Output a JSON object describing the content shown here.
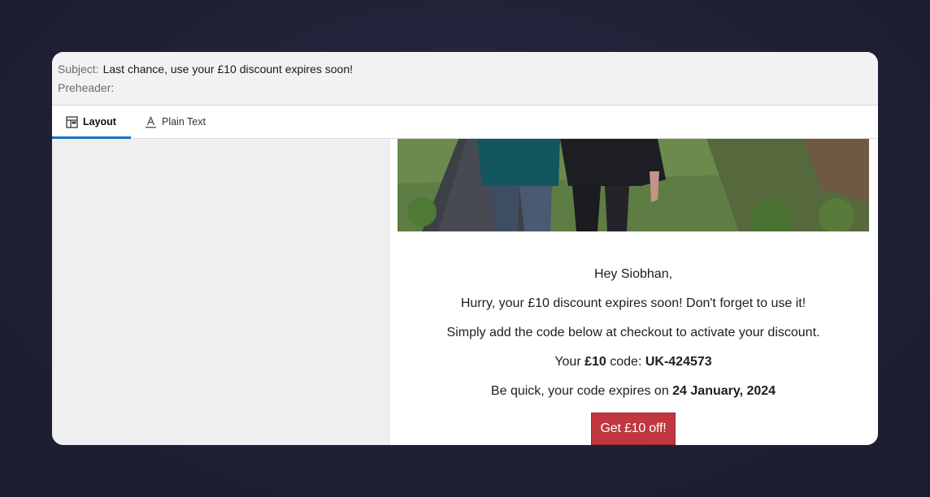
{
  "header": {
    "subject_label": "Subject:",
    "subject_value": "Last chance, use your £10 discount expires soon!",
    "preheader_label": "Preheader:",
    "preheader_value": ""
  },
  "tabs": [
    {
      "label": "Layout",
      "icon": "layout-icon",
      "active": true
    },
    {
      "label": "Plain Text",
      "icon": "text-format-icon",
      "active": false
    }
  ],
  "email": {
    "greeting": "Hey Siobhan,",
    "line1": "Hurry, your £10 discount expires soon! Don't forget to use it!",
    "line2": "Simply add the code below at checkout to activate your discount.",
    "code_prefix": "Your ",
    "code_amount": "£10",
    "code_mid": " code: ",
    "code_value": "UK-424573",
    "expiry_prefix": "Be quick, your code expires on ",
    "expiry_date": "24 January, 2024",
    "cta_label": "Get £10 off!"
  },
  "colors": {
    "accent_tab": "#1a6fc9",
    "cta_background": "#c2373f",
    "background": "#1f2035"
  }
}
